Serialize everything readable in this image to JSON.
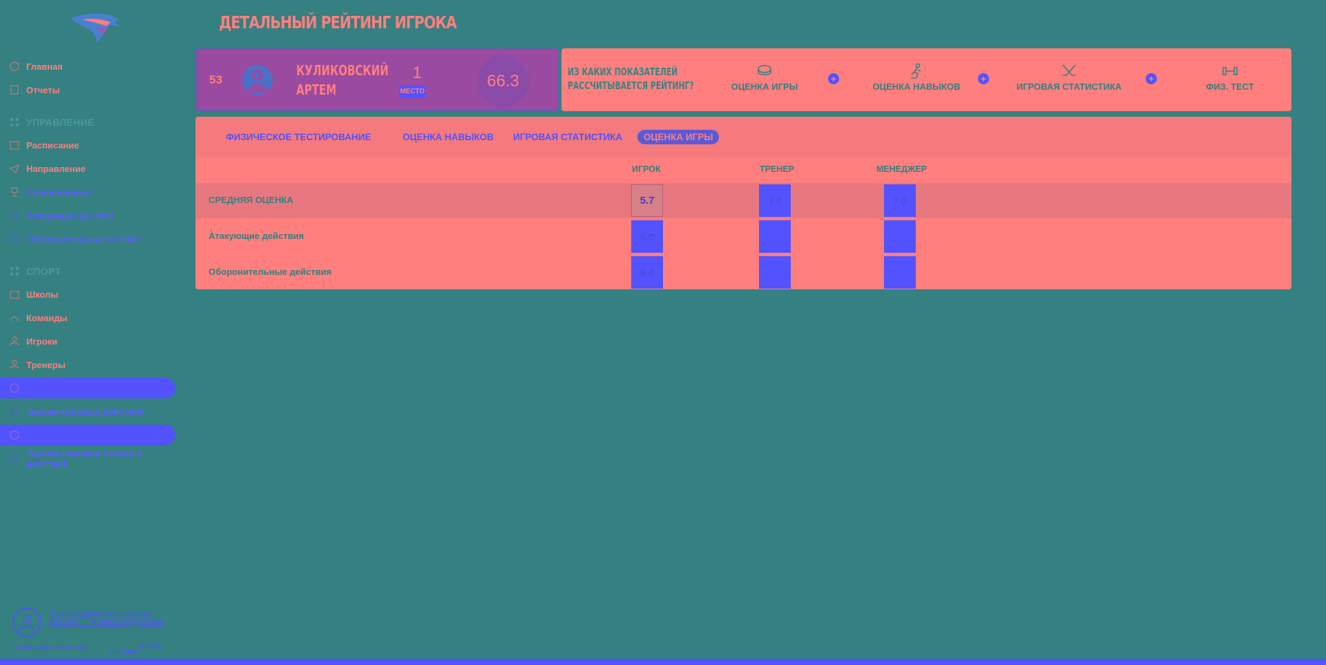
{
  "app": {
    "page_title": "ДЕТАЛЬНЫЙ РЕЙТИНГ ИГРОКА"
  },
  "sidebar": {
    "items_top": [
      {
        "label": "Главная",
        "icon": "home-icon"
      },
      {
        "label": "Отчеты",
        "icon": "report-icon"
      }
    ],
    "section_manage": "УПРАВЛЕНИЕ",
    "items_manage": [
      {
        "label": "Расписание",
        "icon": "calendar-icon"
      },
      {
        "label": "Направление",
        "icon": "direction-icon"
      },
      {
        "label": "Соревнования",
        "icon": "trophy-icon"
      },
      {
        "label": "Атакующие из ОФП",
        "icon": "attack-icon"
      },
      {
        "label": "Оборонительные из ОФП",
        "icon": "defense-icon"
      }
    ],
    "section_sport": "СПОРТ",
    "items_sport": [
      {
        "label": "Школы",
        "icon": "school-icon"
      },
      {
        "label": "Команды",
        "icon": "team-icon"
      },
      {
        "label": "Игроки",
        "icon": "player-icon"
      },
      {
        "label": "Тренеры",
        "icon": "coach-icon"
      },
      {
        "label": "",
        "icon": "rating-icon"
      },
      {
        "label": "Оценки игровых действий",
        "icon": "ratings-icon"
      },
      {
        "label": "",
        "icon": "stats-icon"
      },
      {
        "label": "Оценки навыков игровых действий",
        "icon": "skills-icon"
      }
    ],
    "user": {
      "name": "Суперадминистратор Дмитр... Александрович",
      "meta": "Суперадминистратор",
      "meta2": "Профиль",
      "exit": "Выйти"
    }
  },
  "player_card": {
    "rank": "53",
    "name_line1": "КУЛИКОВСКИЙ",
    "name_line2": "АРТЕМ",
    "place": "1",
    "place_label": "МЕСТО",
    "score": "66.3"
  },
  "formula": {
    "question_line1": "ИЗ КАКИХ ПОКАЗАТЕЛЕЙ",
    "question_line2": "РАССЧИТЫВАЕТСЯ РЕЙТИНГ?",
    "components": [
      {
        "label": "ОЦЕНКА ИГРЫ",
        "icon": "puck-icon"
      },
      {
        "label": "ОЦЕНКА НАВЫКОВ",
        "icon": "skater-icon"
      },
      {
        "label": "ИГРОВАЯ СТАТИСТИКА",
        "icon": "crossed-sticks-icon"
      },
      {
        "label": "ФИЗ. ТЕСТ",
        "icon": "dumbbell-icon"
      }
    ],
    "plus": "+"
  },
  "tabs": [
    {
      "label": "ФИЗИЧЕСКОЕ ТЕСТИРОВАНИЕ",
      "active": false
    },
    {
      "label": "ОЦЕНКА НАВЫКОВ",
      "active": false
    },
    {
      "label": "ИГРОВАЯ СТАТИСТИКА",
      "active": false
    },
    {
      "label": "ОЦЕНКА ИГРЫ",
      "active": true
    }
  ],
  "table": {
    "columns": [
      "ИГРОК",
      "ТРЕНЕР",
      "МЕНЕДЖЕР"
    ],
    "rows": [
      {
        "label": "СРЕДНЯЯ ОЦЕНКА",
        "player": "5.7",
        "coach": "7.0",
        "manager": "7.0"
      },
      {
        "label": "Атакующие действия",
        "player": "6.0",
        "coach": "",
        "manager": ""
      },
      {
        "label": "Оборонительные действия",
        "player": "6.0",
        "coach": "",
        "manager": ""
      }
    ]
  }
}
